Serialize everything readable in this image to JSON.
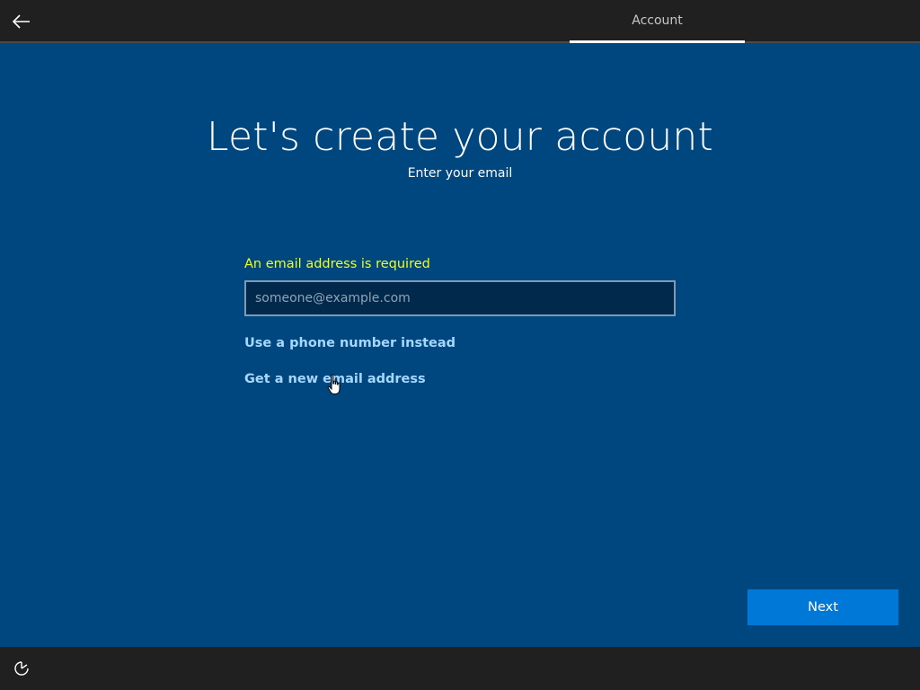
{
  "header": {
    "back_icon": "arrow-left-icon",
    "tab_label": "Account"
  },
  "main": {
    "title": "Let's create your account",
    "subtitle": "Enter your email",
    "error": "An email address is required",
    "email": {
      "value": "",
      "placeholder": "someone@example.com"
    },
    "links": {
      "phone": "Use a phone number instead",
      "new_email": "Get a new email address"
    }
  },
  "footer": {
    "next_label": "Next",
    "accessibility_icon": "ease-of-access-icon"
  },
  "colors": {
    "background": "#00467f",
    "bar": "#202020",
    "accent": "#0078d7",
    "error": "#f0ff1e",
    "link": "#a6d8ff"
  }
}
